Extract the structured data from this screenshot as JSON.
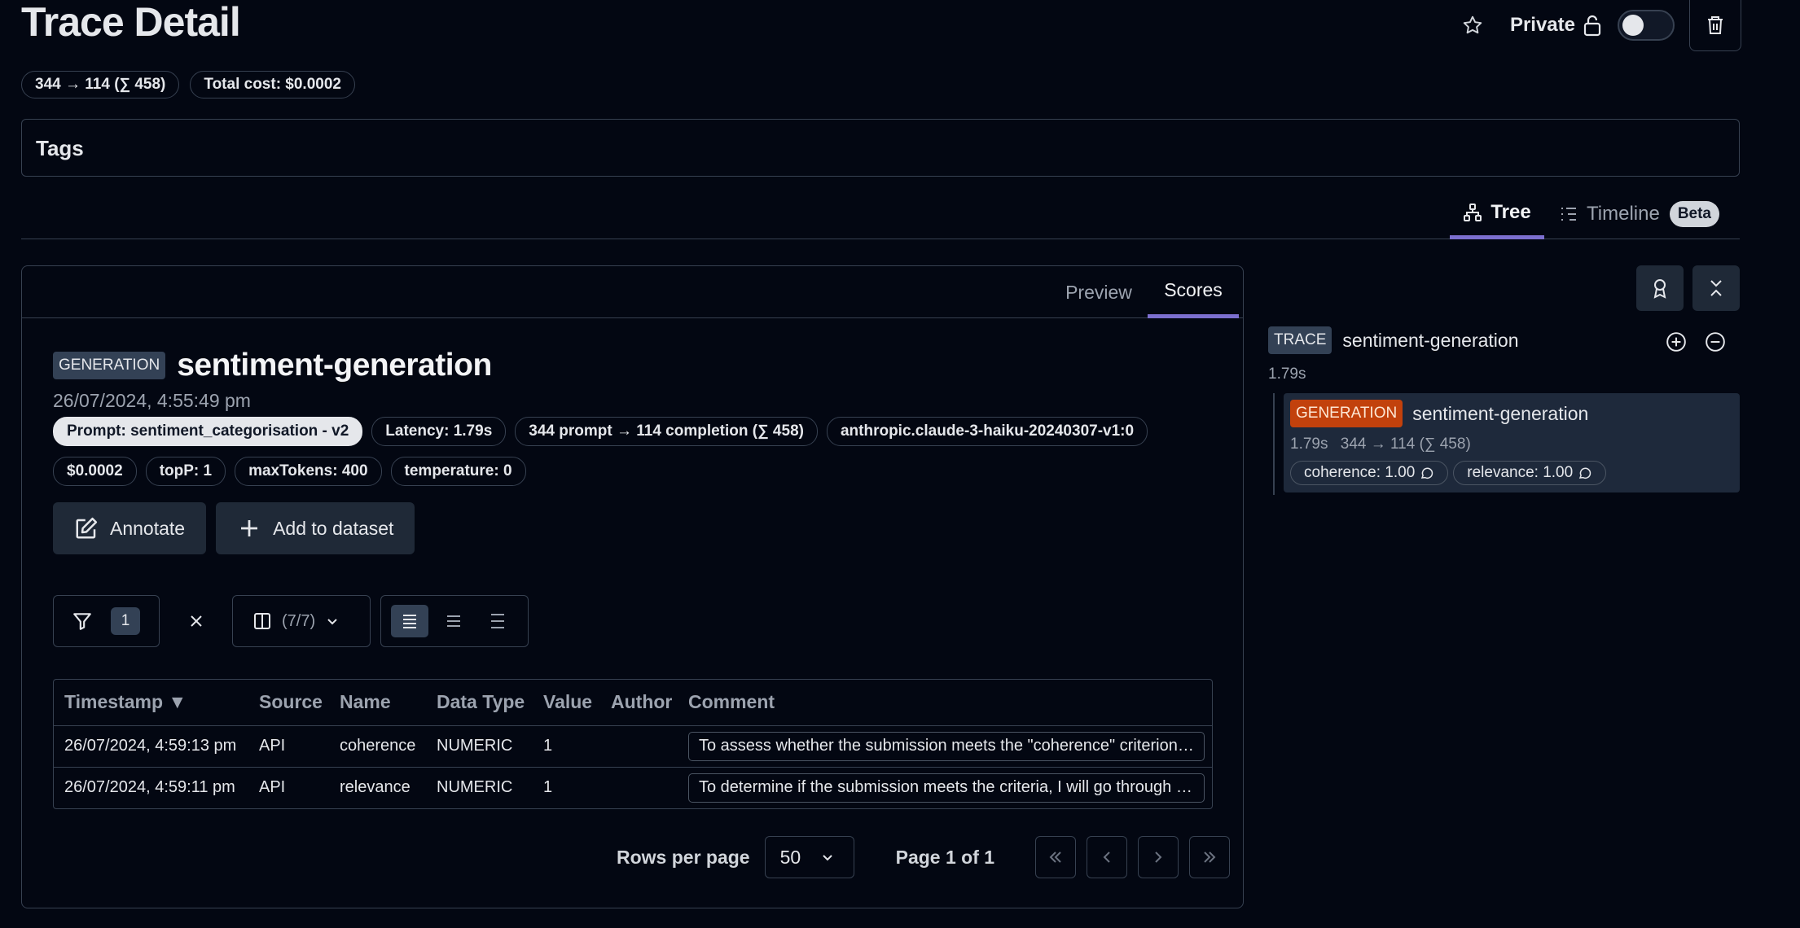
{
  "header": {
    "title": "Trace Detail",
    "private_label": "Private",
    "usage_pill": "344 → 114 (∑ 458)",
    "cost_pill": "Total cost: $0.0002"
  },
  "tags": {
    "label": "Tags"
  },
  "view_tabs": {
    "tree": "Tree",
    "timeline": "Timeline",
    "beta": "Beta",
    "active": "Tree"
  },
  "panel": {
    "tabs": {
      "preview": "Preview",
      "scores": "Scores",
      "active": "Scores"
    },
    "badge": "GENERATION",
    "name": "sentiment-generation",
    "timestamp": "26/07/2024, 4:55:49 pm",
    "meta_row1": [
      "Prompt: sentiment_categorisation - v2",
      "Latency: 1.79s",
      "344 prompt → 114 completion (∑ 458)",
      "anthropic.claude-3-haiku-20240307-v1:0"
    ],
    "meta_row2": [
      "$0.0002",
      "topP: 1",
      "maxTokens: 400",
      "temperature: 0"
    ],
    "annotate_label": "Annotate",
    "add_dataset_label": "Add to dataset",
    "filter_count": "1",
    "columns_label": "(7/7)",
    "table": {
      "headers": [
        "Timestamp ▼",
        "Source",
        "Name",
        "Data Type",
        "Value",
        "Author",
        "Comment"
      ],
      "rows": [
        [
          "26/07/2024, 4:59:13 pm",
          "API",
          "coherence",
          "NUMERIC",
          "1",
          "",
          "To assess whether the submission meets the \"coherence\" criterion, I will go through the steps"
        ],
        [
          "26/07/2024, 4:59:11 pm",
          "API",
          "relevance",
          "NUMERIC",
          "1",
          "",
          "To determine if the submission meets the criteria, I will go through the steps"
        ]
      ]
    },
    "pagination": {
      "rows_per_page_label": "Rows per page",
      "rows_per_page": "50",
      "page_label": "Page 1 of 1"
    }
  },
  "tree": {
    "trace_badge": "TRACE",
    "trace_name": "sentiment-generation",
    "trace_latency": "1.79s",
    "gen_badge": "GENERATION",
    "gen_name": "sentiment-generation",
    "gen_latency": "1.79s",
    "gen_usage": "344 → 114 (∑ 458)",
    "scores": [
      "coherence: 1.00",
      "relevance: 1.00"
    ]
  },
  "colors": {
    "background": "#030712",
    "accent": "#7c6fcf",
    "generation_badge": "#c2410c",
    "border": "#374151"
  }
}
